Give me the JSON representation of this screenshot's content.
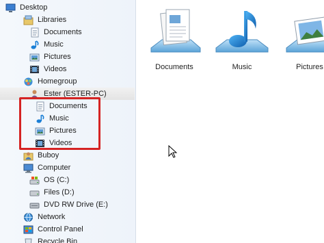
{
  "nav": {
    "items": [
      {
        "label": "Desktop",
        "icon": "desktop-icon"
      },
      {
        "label": "Libraries",
        "icon": "libraries-icon"
      },
      {
        "label": "Documents",
        "icon": "documents-icon"
      },
      {
        "label": "Music",
        "icon": "music-icon"
      },
      {
        "label": "Pictures",
        "icon": "pictures-icon"
      },
      {
        "label": "Videos",
        "icon": "videos-icon"
      },
      {
        "label": "Homegroup",
        "icon": "homegroup-icon"
      },
      {
        "label": "Ester (ESTER-PC)",
        "icon": "user-icon"
      },
      {
        "label": "Documents",
        "icon": "documents-icon"
      },
      {
        "label": "Music",
        "icon": "music-icon"
      },
      {
        "label": "Pictures",
        "icon": "pictures-icon"
      },
      {
        "label": "Videos",
        "icon": "videos-icon"
      },
      {
        "label": "Buboy",
        "icon": "user-icon"
      },
      {
        "label": "Computer",
        "icon": "computer-icon"
      },
      {
        "label": "OS (C:)",
        "icon": "drive-icon"
      },
      {
        "label": "Files (D:)",
        "icon": "drive-icon"
      },
      {
        "label": "DVD RW Drive (E:)",
        "icon": "dvd-drive-icon"
      },
      {
        "label": "Network",
        "icon": "network-icon"
      },
      {
        "label": "Control Panel",
        "icon": "control-panel-icon"
      },
      {
        "label": "Recycle Bin",
        "icon": "recycle-bin-icon"
      }
    ]
  },
  "content": {
    "tiles": [
      {
        "label": "Documents",
        "icon": "documents-library-icon"
      },
      {
        "label": "Music",
        "icon": "music-library-icon"
      },
      {
        "label": "Pictures",
        "icon": "pictures-library-icon"
      }
    ]
  },
  "colors": {
    "highlight_box": "#d52323",
    "music_note": "#1b7fd6"
  }
}
